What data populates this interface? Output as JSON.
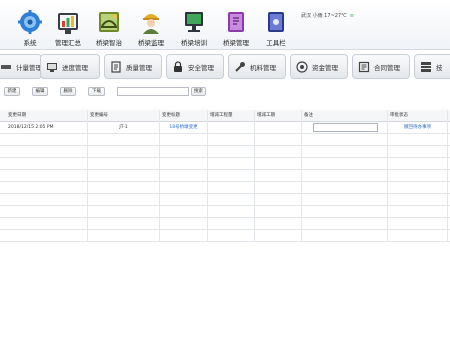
{
  "top_menu": [
    {
      "label": "系统",
      "icon": "gear-icon"
    },
    {
      "label": "管理汇总",
      "icon": "chart-icon"
    },
    {
      "label": "桥梁智治",
      "icon": "bridge-panel-icon"
    },
    {
      "label": "桥梁监理",
      "icon": "worker-icon"
    },
    {
      "label": "桥梁培训",
      "icon": "monitor-icon"
    },
    {
      "label": "桥梁管理",
      "icon": "book-icon"
    },
    {
      "label": "工具栏",
      "icon": "toolbox-icon"
    }
  ],
  "weather": {
    "text": "武汉 小雨 17~27℃",
    "flag": "≡"
  },
  "modules": [
    {
      "label": "计量管理",
      "icon": "ruler-icon"
    },
    {
      "label": "进度管理",
      "icon": "progress-monitor-icon"
    },
    {
      "label": "质量管理",
      "icon": "document-icon"
    },
    {
      "label": "安全管理",
      "icon": "lock-icon"
    },
    {
      "label": "机料管理",
      "icon": "wrench-icon"
    },
    {
      "label": "资金管理",
      "icon": "coin-icon"
    },
    {
      "label": "合同管理",
      "icon": "contract-icon"
    },
    {
      "label": "技",
      "icon": "tech-icon"
    }
  ],
  "toolbar": {
    "new_label": "新建",
    "edit_label": "编辑",
    "delete_label": "删除",
    "download_label": "下载",
    "search_placeholder": "",
    "search_label": "搜索"
  },
  "table": {
    "columns": [
      "变更日期",
      "变更编号",
      "变更标题",
      "增减工程量",
      "增减工期",
      "备注",
      "审批状态"
    ],
    "rows": [
      {
        "date": "2018/12/15 2:05 PM",
        "code": "JT-1",
        "title": "18号桥墩变更",
        "qty": "",
        "days": "",
        "remark": "",
        "status": "撤回待办事项"
      }
    ]
  },
  "colors": {
    "accent": "#2b6cc4",
    "border": "#c9ced6",
    "header_bg": "#f4f6f8"
  }
}
